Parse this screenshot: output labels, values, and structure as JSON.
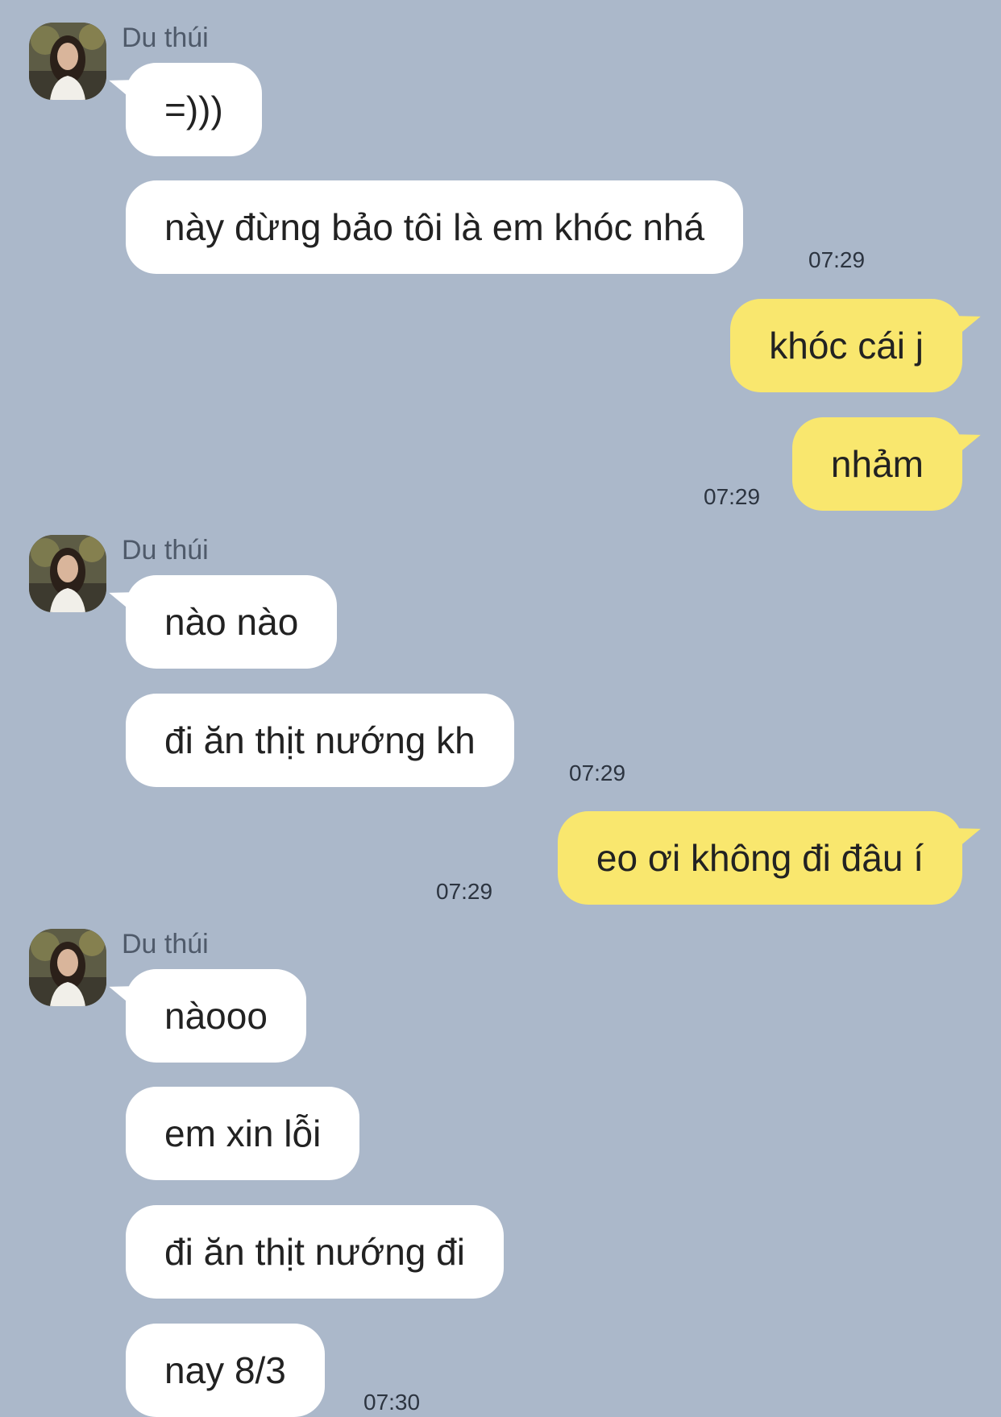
{
  "contact": {
    "name": "Du thúi"
  },
  "messages": [
    {
      "from": "contact",
      "text": "=)))"
    },
    {
      "from": "contact",
      "text": "này đừng bảo tôi là em khóc nhá",
      "time": "07:29"
    },
    {
      "from": "me",
      "text": "khóc cái j"
    },
    {
      "from": "me",
      "text": "nhảm",
      "time": "07:29"
    },
    {
      "from": "contact",
      "text": "nào nào"
    },
    {
      "from": "contact",
      "text": "đi ăn thịt nướng kh",
      "time": "07:29"
    },
    {
      "from": "me",
      "text": "eo ơi không đi đâu í",
      "time": "07:29"
    },
    {
      "from": "contact",
      "text": "nàooo"
    },
    {
      "from": "contact",
      "text": "em xin lỗi"
    },
    {
      "from": "contact",
      "text": "đi ăn thịt nướng đi"
    },
    {
      "from": "contact",
      "text": "nay 8/3",
      "time": "07:30"
    }
  ],
  "colors": {
    "background": "#abb8ca",
    "incoming_bubble": "#ffffff",
    "outgoing_bubble": "#f9e76e"
  },
  "icons": {
    "avatar": "contact-avatar-photo"
  }
}
